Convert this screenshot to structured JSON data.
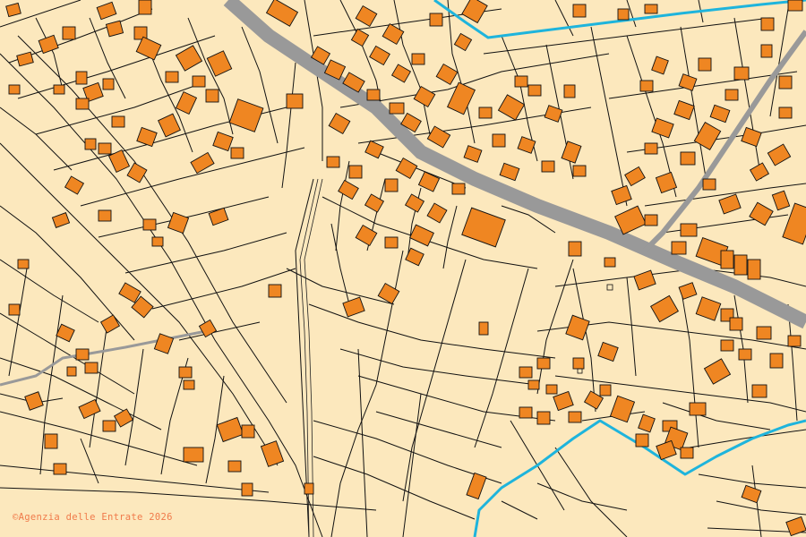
{
  "map": {
    "type": "cadastral-parcel-map",
    "layers": [
      "parcels",
      "buildings",
      "roads",
      "waterways"
    ],
    "colors": {
      "parcel_fill": "#fce8bd",
      "parcel_border": "#000000",
      "building_fill": "#ef8622",
      "road": "#999999",
      "water": "#1eb4dc",
      "attribution": "#f07a4a"
    }
  },
  "attribution": {
    "text": "©Agenzia delle Entrate 2026"
  }
}
